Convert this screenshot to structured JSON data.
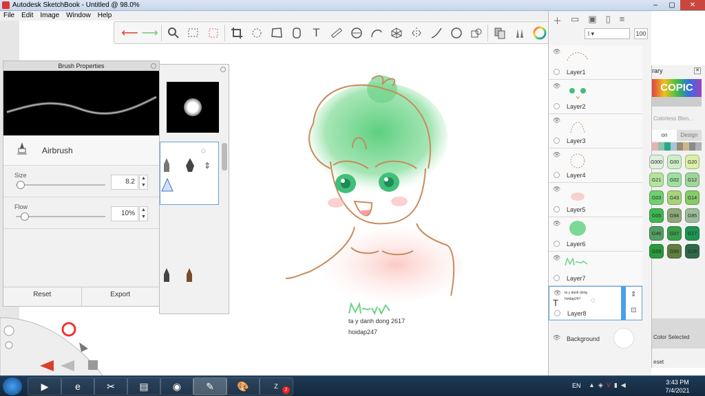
{
  "window": {
    "title": "Autodesk SketchBook - Untitled @ 98.0%",
    "min": "–",
    "max": "▢",
    "close": "✕"
  },
  "menu": [
    "File",
    "Edit",
    "Image",
    "Window",
    "Help"
  ],
  "toolbar": {
    "icons": [
      "undo-icon",
      "redo-icon",
      "zoom-icon",
      "select-rect-icon",
      "select-lasso-icon",
      "crop-icon",
      "transform-icon",
      "distort-icon",
      "fill-icon",
      "text-icon",
      "ruler-icon",
      "ellipse-guide-icon",
      "french-curve-icon",
      "perspective-icon",
      "symmetry-icon",
      "stroke-icon",
      "shape-icon",
      "layers-icon",
      "copy-icon",
      "brushes-icon",
      "color-wheel-icon",
      "swatches-icon"
    ]
  },
  "brush_properties": {
    "title": "Brush Properties",
    "brush_name": "Airbrush",
    "size": {
      "label": "Size",
      "value": "8.2",
      "fraction": 0.05
    },
    "flow": {
      "label": "Flow",
      "value": "10%",
      "fraction": 0.1
    },
    "reset_label": "Reset",
    "export_label": "Export"
  },
  "layers": {
    "opacity": "100",
    "items": [
      {
        "name": "Layer1"
      },
      {
        "name": "Layer2"
      },
      {
        "name": "Layer3"
      },
      {
        "name": "Layer4"
      },
      {
        "name": "Layer5"
      },
      {
        "name": "Layer6"
      },
      {
        "name": "Layer7"
      },
      {
        "name": "Layer8",
        "selected": true,
        "thumb_text1": "ta y danh dong",
        "thumb_text2": "hoidap247"
      }
    ],
    "background_label": "Background"
  },
  "copic": {
    "title": "rary",
    "colorless": "Colorless Blen...",
    "tab_left": "on",
    "tab_right": "Design",
    "swatches": [
      {
        "code": "G\n000",
        "color": "#dff0dc"
      },
      {
        "code": "G00",
        "color": "#cfeec8"
      },
      {
        "code": "G20",
        "color": "#dcefa8"
      },
      {
        "code": "G21",
        "color": "#b5e49e"
      },
      {
        "code": "G02",
        "color": "#9ee0a0"
      },
      {
        "code": "G12",
        "color": "#9ed69a"
      },
      {
        "code": "G03",
        "color": "#6fd06e"
      },
      {
        "code": "G43",
        "color": "#a7d37a"
      },
      {
        "code": "G14",
        "color": "#84cb6a"
      },
      {
        "code": "G05",
        "color": "#3fb752"
      },
      {
        "code": "G94",
        "color": "#8fa77a"
      },
      {
        "code": "G85",
        "color": "#9cbd9c"
      },
      {
        "code": "G46",
        "color": "#539e63"
      },
      {
        "code": "G07",
        "color": "#3a9e4a"
      },
      {
        "code": "G17",
        "color": "#1f9455"
      },
      {
        "code": "G09",
        "color": "#2a9a3e"
      },
      {
        "code": "G99",
        "color": "#5f7f3f"
      },
      {
        "code": "G28",
        "color": "#2e6a4a"
      }
    ],
    "color_selected": "Color Selected",
    "reset": "eset"
  },
  "drawing": {
    "signature": "Mayy",
    "caption1": "ta y danh dong 2617",
    "caption2": "hoidap247",
    "hair_color": "#6fd38a",
    "line_color": "#c98a5a",
    "skin_color": "#f7b9ae",
    "eye_color": "#3fbf7a"
  },
  "taskbar": {
    "lang": "EN",
    "time": "3:43 PM",
    "date": "7/4/2021",
    "zalo_badge": "2"
  }
}
